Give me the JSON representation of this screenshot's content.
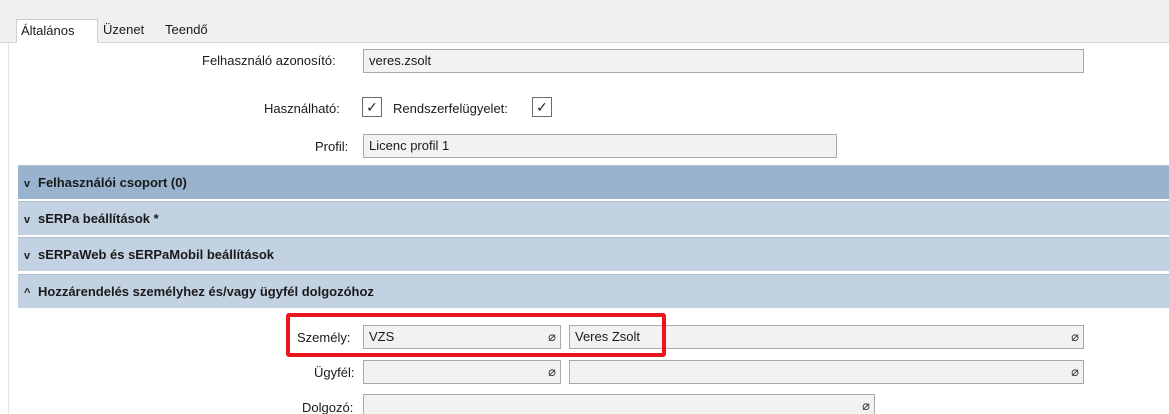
{
  "tabs": [
    {
      "label": "Általános"
    },
    {
      "label": "Üzenet"
    },
    {
      "label": "Teendő"
    }
  ],
  "general": {
    "user_id_label": "Felhasználó azonosító:",
    "user_id_value": "veres.zsolt",
    "usable_label": "Használható:",
    "usable_checked": "✓",
    "sysadmin_label": "Rendszerfelügyelet:",
    "sysadmin_checked": "✓",
    "profile_label": "Profil:",
    "profile_value": "Licenc profil 1"
  },
  "sections": [
    {
      "chevron": "v",
      "label": "Felhasználói csoport (0)"
    },
    {
      "chevron": "v",
      "label": "sERPa beállítások *"
    },
    {
      "chevron": "v",
      "label": "sERPaWeb és sERPaMobil beállítások"
    },
    {
      "chevron": "^",
      "label": "Hozzárendelés személyhez és/vagy ügyfél dolgozóhoz"
    }
  ],
  "assignment": {
    "person_label": "Személy:",
    "person_code": "VZS",
    "person_name": "Veres Zsolt",
    "client_label": "Ügyfél:",
    "client_code": "",
    "client_name": "",
    "employee_label": "Dolgozó:",
    "employee_value": ""
  },
  "icons": {
    "attach": "paperclip-icon",
    "checkmark": "checkmark-icon",
    "chevron_down": "chevron-down-icon",
    "chevron_up": "chevron-up-icon"
  },
  "colors": {
    "section_bg": "#c2d2e2",
    "section_bg_dark": "#99b3ce",
    "highlight": "#e8161c",
    "field_bg": "#f2f2f2"
  }
}
